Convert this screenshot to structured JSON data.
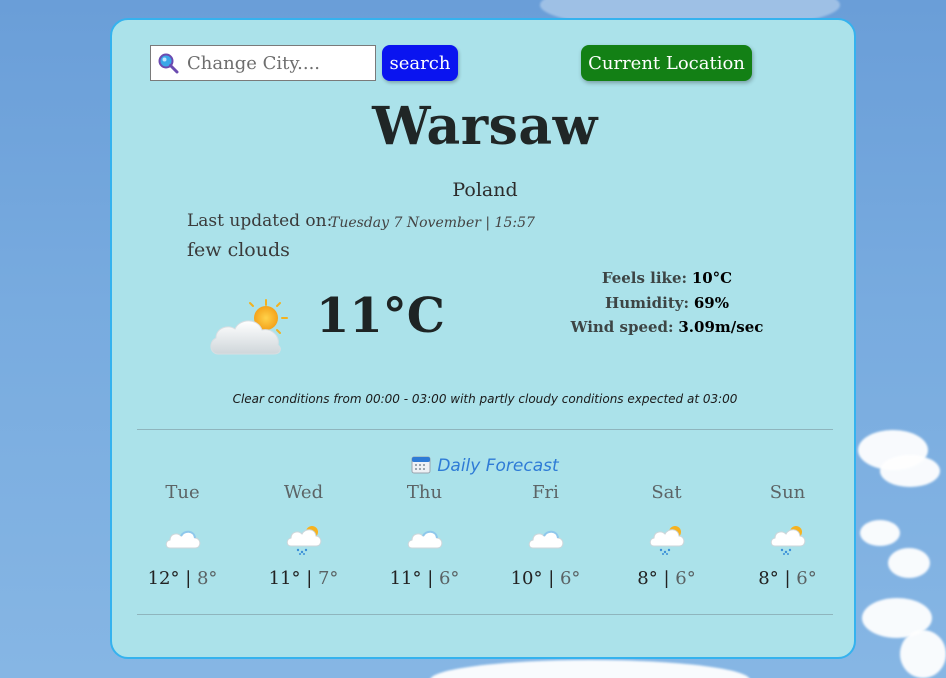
{
  "search": {
    "placeholder": "Change City....",
    "button_label": "search",
    "location_button_label": "Current Location"
  },
  "current": {
    "city": "Warsaw",
    "country": "Poland",
    "last_updated_label": "Last updated on:",
    "last_updated_value": "Tuesday 7 November | 15:57",
    "description": "few clouds",
    "icon": "partly-cloudy-icon",
    "temperature": "11°C",
    "feels_like_label": "Feels like:",
    "feels_like_value": "10°C",
    "humidity_label": "Humidity:",
    "humidity_value": "69%",
    "wind_label": "Wind speed:",
    "wind_value": "3.09m/sec"
  },
  "forecast_note": "Clear conditions from 00:00 - 03:00 with partly cloudy conditions expected at 03:00",
  "daily": {
    "heading": "Daily Forecast",
    "days": [
      {
        "name": "Tue",
        "icon": "cloudy-icon",
        "high": "12°",
        "low": "8°"
      },
      {
        "name": "Wed",
        "icon": "rain-sun-icon",
        "high": "11°",
        "low": "7°"
      },
      {
        "name": "Thu",
        "icon": "cloudy-icon",
        "high": "11°",
        "low": "6°"
      },
      {
        "name": "Fri",
        "icon": "cloudy-icon",
        "high": "10°",
        "low": "6°"
      },
      {
        "name": "Sat",
        "icon": "rain-sun-icon",
        "high": "8°",
        "low": "6°"
      },
      {
        "name": "Sun",
        "icon": "rain-sun-icon",
        "high": "8°",
        "low": "6°"
      }
    ]
  },
  "colors": {
    "card_bg": "#abe2ea",
    "card_border": "#35b2ee",
    "search_button": "#0a14f0",
    "location_button": "#138015",
    "heading_blue": "#2e7bd6"
  }
}
